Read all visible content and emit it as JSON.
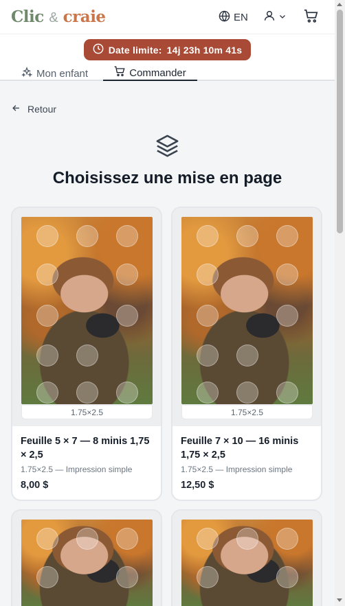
{
  "header": {
    "logo": {
      "part1": "Clic",
      "amp": "&",
      "part2": "craie"
    },
    "lang_label": "EN"
  },
  "deadline": {
    "label": "Date limite:",
    "countdown": "14j 23h 10m 41s"
  },
  "tabs": [
    {
      "label": "Mon enfant",
      "icon": "sparkles-icon",
      "active": false
    },
    {
      "label": "Commander",
      "icon": "cart-icon",
      "active": true
    }
  ],
  "back_label": "Retour",
  "page_title": "Choisissez une mise en page",
  "cards": [
    {
      "size_tag": "1.75×2.5",
      "title": "Feuille 5 × 7 — 8 minis 1,75 × 2,5",
      "subtitle": "1.75×2.5 — Impression simple",
      "price": "8,00 $"
    },
    {
      "size_tag": "1.75×2.5",
      "title": "Feuille 7 × 10 — 16 minis 1,75 × 2,5",
      "subtitle": "1.75×2.5 — Impression simple",
      "price": "12,50 $"
    }
  ],
  "colors": {
    "accent": "#a84a35",
    "logo_green": "#6f8a6a",
    "logo_orange": "#c8764a"
  }
}
